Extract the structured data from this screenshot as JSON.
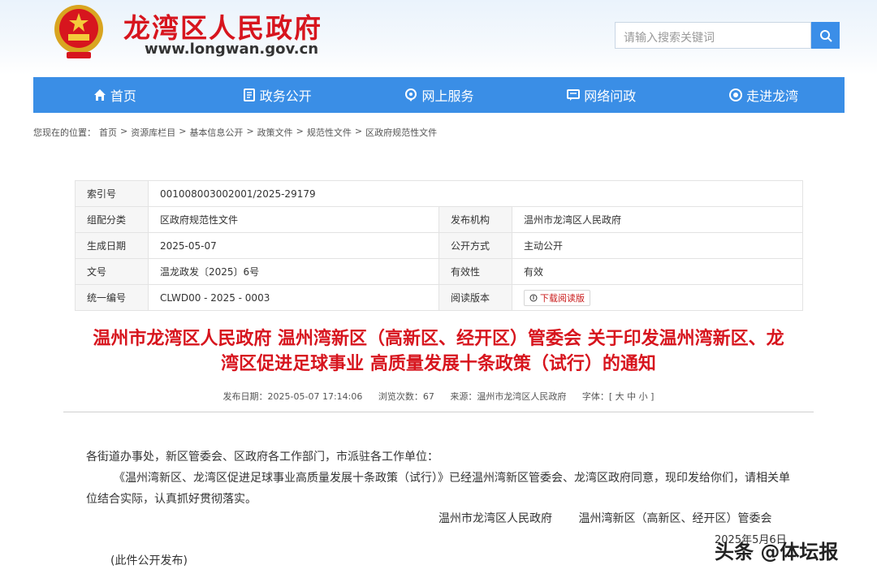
{
  "header": {
    "site_name": "龙湾区人民政府",
    "site_url": "www.longwan.gov.cn",
    "search_placeholder": "请输入搜索关键词"
  },
  "nav": [
    {
      "label": "首页",
      "icon": "home-icon"
    },
    {
      "label": "政务公开",
      "icon": "document-icon"
    },
    {
      "label": "网上服务",
      "icon": "location-icon"
    },
    {
      "label": "网络问政",
      "icon": "chat-icon"
    },
    {
      "label": "走进龙湾",
      "icon": "eye-icon"
    }
  ],
  "breadcrumb": {
    "prefix": "您现在的位置：",
    "items": [
      "首页",
      "资源库栏目",
      "基本信息公开",
      "政策文件",
      "规范性文件",
      "区政府规范性文件"
    ]
  },
  "info": {
    "index_label": "索引号",
    "index_value": "001008003002001/2025-29179",
    "category_label": "组配分类",
    "category_value": "区政府规范性文件",
    "org_label": "发布机构",
    "org_value": "温州市龙湾区人民政府",
    "date_label": "生成日期",
    "date_value": "2025-05-07",
    "open_label": "公开方式",
    "open_value": "主动公开",
    "docno_label": "文号",
    "docno_value": "温龙政发〔2025〕6号",
    "valid_label": "有效性",
    "valid_value": "有效",
    "code_label": "统一编号",
    "code_value": "CLWD00 - 2025 - 0003",
    "read_label": "阅读版本",
    "download_label": "下载阅读版"
  },
  "doc": {
    "title_line1": "温州市龙湾区人民政府 温州湾新区（高新区、经开区）管委会 关于印发温州湾新区、龙",
    "title_line2": "湾区促进足球事业 高质量发展十条政策（试行）的通知",
    "publish_date": "发布日期：2025-05-07 17:14:06",
    "views": "浏览次数：67",
    "source": "来源：温州市龙湾区人民政府",
    "font_size": "字体：[ 大 中 小 ]",
    "para1": "各街道办事处，新区管委会、区政府各工作部门，市派驻各工作单位：",
    "para2": "《温州湾新区、龙湾区促进足球事业高质量发展十条政策（试行）》已经温州湾新区管委会、龙湾区政府同意，现印发给你们，请相关单位结合实际，认真抓好贯彻落实。",
    "signer1": "温州市龙湾区人民政府",
    "signer2": "温州湾新区（高新区、经开区）管委会",
    "sign_date": "2025年5月6日",
    "note": "(此件公开发布)"
  },
  "watermark": "头条 @体坛报"
}
